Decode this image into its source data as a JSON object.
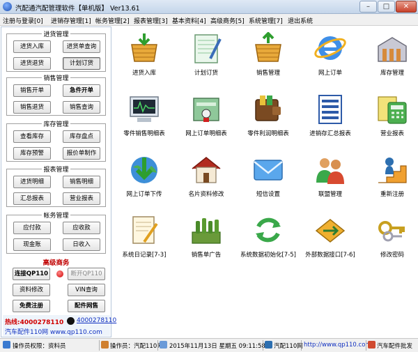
{
  "window": {
    "title": "汽配通汽配管理软件【单机版】 Ver13.61",
    "controls": [
      "–",
      "□",
      "✕"
    ]
  },
  "menu": [
    "注册与登录[0]",
    "进销存管理[1]",
    "帐务管理[2]",
    "报表管理[3]",
    "基本资料[4]",
    "高级商务[5]",
    "系统管理[7]",
    "退出系统"
  ],
  "sidebar": {
    "groups": [
      {
        "title": "进货管理",
        "buttons": [
          "进货入库",
          "进货单查询",
          "进货退货",
          "计划订货"
        ]
      },
      {
        "title": "销售管理",
        "buttons": [
          "销售开单",
          "急件开单",
          "销售退货",
          "销售查询"
        ]
      },
      {
        "title": "库存管理",
        "buttons": [
          "查看库存",
          "库存盘点",
          "库存预警",
          "报价单制作"
        ]
      },
      {
        "title": "报表管理",
        "buttons": [
          "进货明细",
          "销售明细",
          "汇总报表",
          "营业报表"
        ]
      },
      {
        "title": "帐务管理",
        "buttons": [
          "应付款",
          "应收款",
          "现金账",
          "日收入"
        ]
      }
    ],
    "advanced": {
      "title": "高级商务",
      "buttons": [
        "连接QP110",
        "断开QP110",
        "资料修改",
        "VIN查询",
        "免费注册",
        "配件网售"
      ]
    },
    "hotline": {
      "label": "热线:4000278110",
      "link": "4000278110",
      "site": "汽车配件110网 www.qp110.com"
    }
  },
  "tiles": [
    {
      "label": "进货入库",
      "icon": "basket-in-icon"
    },
    {
      "label": "计划订货",
      "icon": "notepad-pen-icon"
    },
    {
      "label": "销售管理",
      "icon": "basket-out-icon"
    },
    {
      "label": "网上订单",
      "icon": "ie-browser-icon"
    },
    {
      "label": "库存管理",
      "icon": "warehouse-icon"
    },
    {
      "label": "零件销售明细表",
      "icon": "monitor-chart-icon"
    },
    {
      "label": "网上订单明细表",
      "icon": "laboratory-icon"
    },
    {
      "label": "零件利润明细表",
      "icon": "wallet-icon"
    },
    {
      "label": "进销存汇总报表",
      "icon": "document-list-icon"
    },
    {
      "label": "营业报表",
      "icon": "calculator-icon"
    },
    {
      "label": "网上订单下传",
      "icon": "globe-download-icon"
    },
    {
      "label": "名片资料修改",
      "icon": "house-icon"
    },
    {
      "label": "短信设置",
      "icon": "envelope-icon"
    },
    {
      "label": "联盟管理",
      "icon": "people-icon"
    },
    {
      "label": "重新注册",
      "icon": "user-stairs-icon"
    },
    {
      "label": "系统日记录[7-3]",
      "icon": "journal-icon"
    },
    {
      "label": "销售单广告",
      "icon": "bottles-icon"
    },
    {
      "label": "系统数据初始化[7-5]",
      "icon": "refresh-icon"
    },
    {
      "label": "外部数据接口[7-6]",
      "icon": "folder-arrows-icon"
    },
    {
      "label": "修改密码",
      "icon": "keys-icon"
    }
  ],
  "statusbar": {
    "permission": "操作员权限：资料员",
    "operator": "操作员：汽配110网",
    "datetime": "2015年11月13日 星期五 09:11:58",
    "site_name": "汽配110网",
    "url": "http://www.qp110.com",
    "ad": "汽车配件批发"
  },
  "colors": {
    "accent": "#1d4fb0",
    "hot": "#c00000",
    "link": "#1030c0"
  }
}
